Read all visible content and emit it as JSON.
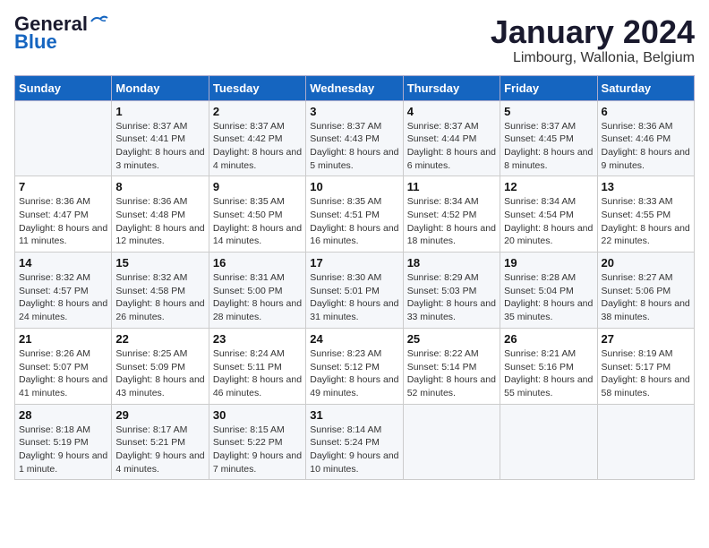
{
  "logo": {
    "line1": "General",
    "line2": "Blue"
  },
  "title": "January 2024",
  "subtitle": "Limbourg, Wallonia, Belgium",
  "days_header": [
    "Sunday",
    "Monday",
    "Tuesday",
    "Wednesday",
    "Thursday",
    "Friday",
    "Saturday"
  ],
  "weeks": [
    [
      {
        "day": "",
        "sunrise": "",
        "sunset": "",
        "daylight": ""
      },
      {
        "day": "1",
        "sunrise": "8:37 AM",
        "sunset": "4:41 PM",
        "daylight": "8 hours and 3 minutes."
      },
      {
        "day": "2",
        "sunrise": "8:37 AM",
        "sunset": "4:42 PM",
        "daylight": "8 hours and 4 minutes."
      },
      {
        "day": "3",
        "sunrise": "8:37 AM",
        "sunset": "4:43 PM",
        "daylight": "8 hours and 5 minutes."
      },
      {
        "day": "4",
        "sunrise": "8:37 AM",
        "sunset": "4:44 PM",
        "daylight": "8 hours and 6 minutes."
      },
      {
        "day": "5",
        "sunrise": "8:37 AM",
        "sunset": "4:45 PM",
        "daylight": "8 hours and 8 minutes."
      },
      {
        "day": "6",
        "sunrise": "8:36 AM",
        "sunset": "4:46 PM",
        "daylight": "8 hours and 9 minutes."
      }
    ],
    [
      {
        "day": "7",
        "sunrise": "8:36 AM",
        "sunset": "4:47 PM",
        "daylight": "8 hours and 11 minutes."
      },
      {
        "day": "8",
        "sunrise": "8:36 AM",
        "sunset": "4:48 PM",
        "daylight": "8 hours and 12 minutes."
      },
      {
        "day": "9",
        "sunrise": "8:35 AM",
        "sunset": "4:50 PM",
        "daylight": "8 hours and 14 minutes."
      },
      {
        "day": "10",
        "sunrise": "8:35 AM",
        "sunset": "4:51 PM",
        "daylight": "8 hours and 16 minutes."
      },
      {
        "day": "11",
        "sunrise": "8:34 AM",
        "sunset": "4:52 PM",
        "daylight": "8 hours and 18 minutes."
      },
      {
        "day": "12",
        "sunrise": "8:34 AM",
        "sunset": "4:54 PM",
        "daylight": "8 hours and 20 minutes."
      },
      {
        "day": "13",
        "sunrise": "8:33 AM",
        "sunset": "4:55 PM",
        "daylight": "8 hours and 22 minutes."
      }
    ],
    [
      {
        "day": "14",
        "sunrise": "8:32 AM",
        "sunset": "4:57 PM",
        "daylight": "8 hours and 24 minutes."
      },
      {
        "day": "15",
        "sunrise": "8:32 AM",
        "sunset": "4:58 PM",
        "daylight": "8 hours and 26 minutes."
      },
      {
        "day": "16",
        "sunrise": "8:31 AM",
        "sunset": "5:00 PM",
        "daylight": "8 hours and 28 minutes."
      },
      {
        "day": "17",
        "sunrise": "8:30 AM",
        "sunset": "5:01 PM",
        "daylight": "8 hours and 31 minutes."
      },
      {
        "day": "18",
        "sunrise": "8:29 AM",
        "sunset": "5:03 PM",
        "daylight": "8 hours and 33 minutes."
      },
      {
        "day": "19",
        "sunrise": "8:28 AM",
        "sunset": "5:04 PM",
        "daylight": "8 hours and 35 minutes."
      },
      {
        "day": "20",
        "sunrise": "8:27 AM",
        "sunset": "5:06 PM",
        "daylight": "8 hours and 38 minutes."
      }
    ],
    [
      {
        "day": "21",
        "sunrise": "8:26 AM",
        "sunset": "5:07 PM",
        "daylight": "8 hours and 41 minutes."
      },
      {
        "day": "22",
        "sunrise": "8:25 AM",
        "sunset": "5:09 PM",
        "daylight": "8 hours and 43 minutes."
      },
      {
        "day": "23",
        "sunrise": "8:24 AM",
        "sunset": "5:11 PM",
        "daylight": "8 hours and 46 minutes."
      },
      {
        "day": "24",
        "sunrise": "8:23 AM",
        "sunset": "5:12 PM",
        "daylight": "8 hours and 49 minutes."
      },
      {
        "day": "25",
        "sunrise": "8:22 AM",
        "sunset": "5:14 PM",
        "daylight": "8 hours and 52 minutes."
      },
      {
        "day": "26",
        "sunrise": "8:21 AM",
        "sunset": "5:16 PM",
        "daylight": "8 hours and 55 minutes."
      },
      {
        "day": "27",
        "sunrise": "8:19 AM",
        "sunset": "5:17 PM",
        "daylight": "8 hours and 58 minutes."
      }
    ],
    [
      {
        "day": "28",
        "sunrise": "8:18 AM",
        "sunset": "5:19 PM",
        "daylight": "9 hours and 1 minute."
      },
      {
        "day": "29",
        "sunrise": "8:17 AM",
        "sunset": "5:21 PM",
        "daylight": "9 hours and 4 minutes."
      },
      {
        "day": "30",
        "sunrise": "8:15 AM",
        "sunset": "5:22 PM",
        "daylight": "9 hours and 7 minutes."
      },
      {
        "day": "31",
        "sunrise": "8:14 AM",
        "sunset": "5:24 PM",
        "daylight": "9 hours and 10 minutes."
      },
      {
        "day": "",
        "sunrise": "",
        "sunset": "",
        "daylight": ""
      },
      {
        "day": "",
        "sunrise": "",
        "sunset": "",
        "daylight": ""
      },
      {
        "day": "",
        "sunrise": "",
        "sunset": "",
        "daylight": ""
      }
    ]
  ]
}
